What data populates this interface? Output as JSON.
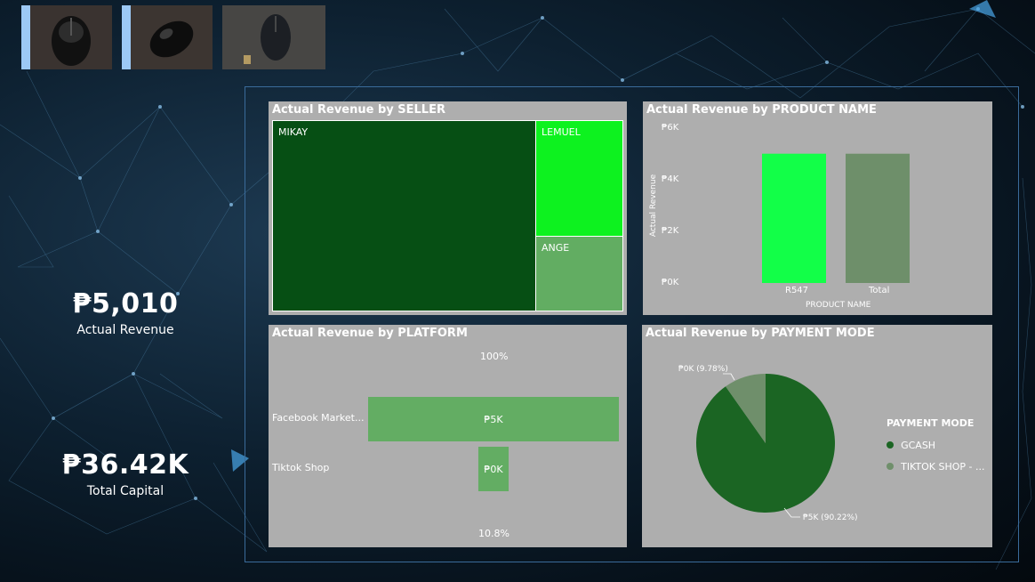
{
  "kpis": [
    {
      "value": "₱5,010",
      "label": "Actual Revenue"
    },
    {
      "value": "₱36.42K",
      "label": "Total Capital"
    }
  ],
  "thumbnails": [
    "mouse-image-1",
    "mouse-image-2",
    "mouse-image-3"
  ],
  "seller": {
    "title": "Actual Revenue by SELLER",
    "cells": [
      "MIKAY",
      "LEMUEL",
      "ANGE"
    ],
    "colors": [
      "#064f14",
      "#0df21f",
      "#62ad62"
    ]
  },
  "product": {
    "title": "Actual Revenue by PRODUCT NAME",
    "y_ticks": [
      "₱6K",
      "₱4K",
      "₱2K",
      "₱0K"
    ],
    "ylabel": "Actual Revenue",
    "xlabel": "PRODUCT NAME",
    "categories": [
      "R547",
      "Total"
    ],
    "colors": [
      "#12ff48",
      "#6e8f6a"
    ]
  },
  "platform": {
    "title": "Actual Revenue by PLATFORM",
    "top_pct": "100%",
    "bottom_pct": "10.8%",
    "rows": [
      {
        "label": "Facebook Market...",
        "value_label": "₱5K"
      },
      {
        "label": "Tiktok Shop",
        "value_label": "₱0K"
      }
    ]
  },
  "payment": {
    "title": "Actual Revenue by PAYMENT MODE",
    "legend_title": "PAYMENT MODE",
    "slices": [
      {
        "name": "GCASH",
        "label": "₱5K (90.22%)",
        "color": "#1b6523"
      },
      {
        "name": "TIKTOK SHOP - ...",
        "label": "₱0K (9.78%)",
        "color": "#6f8f6b"
      }
    ]
  },
  "chart_data": [
    {
      "type": "bar",
      "title": "Actual Revenue by PRODUCT NAME",
      "xlabel": "PRODUCT NAME",
      "ylabel": "Actual Revenue",
      "categories": [
        "R547",
        "Total"
      ],
      "values": [
        5010,
        5010
      ],
      "ylim": [
        0,
        6000
      ]
    },
    {
      "type": "bar",
      "title": "Actual Revenue by PLATFORM",
      "categories": [
        "Facebook Market...",
        "Tiktok Shop"
      ],
      "values": [
        4470,
        540
      ]
    },
    {
      "type": "pie",
      "title": "Actual Revenue by PAYMENT MODE",
      "categories": [
        "GCASH",
        "TIKTOK SHOP - ..."
      ],
      "values": [
        90.22,
        9.78
      ]
    },
    {
      "type": "heatmap",
      "title": "Actual Revenue by SELLER",
      "categories": [
        "MIKAY",
        "LEMUEL",
        "ANGE"
      ]
    }
  ]
}
